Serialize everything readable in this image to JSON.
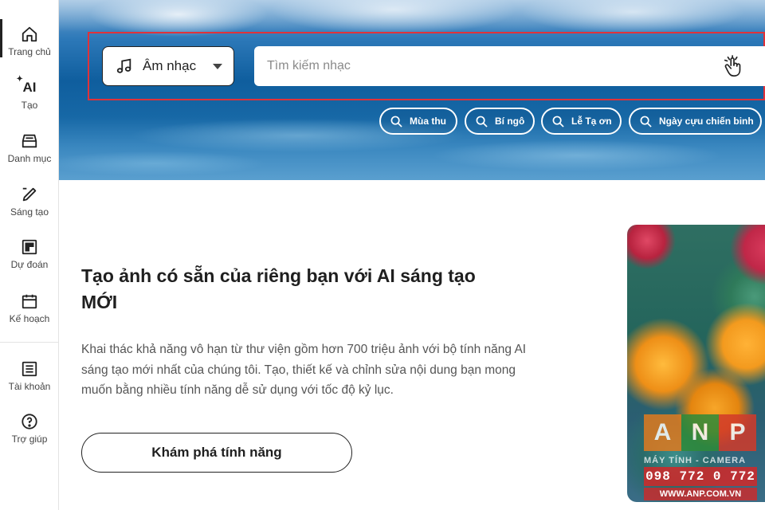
{
  "sidebar": {
    "items": [
      {
        "label": "Trang chủ",
        "icon": "home-icon"
      },
      {
        "label": "Tạo",
        "icon": "ai-sparkle-icon",
        "icon_text": "AI"
      },
      {
        "label": "Danh mục",
        "icon": "inbox-tray-icon"
      },
      {
        "label": "Sáng tạo",
        "icon": "edit-pen-icon"
      },
      {
        "label": "Dự đoán",
        "icon": "grid-dashboard-icon"
      },
      {
        "label": "Kế hoạch",
        "icon": "calendar-icon"
      },
      {
        "label": "Tài khoản",
        "icon": "list-account-icon"
      },
      {
        "label": "Trợ giúp",
        "icon": "help-circle-icon"
      }
    ],
    "active_index": 0
  },
  "search": {
    "type_selected": "Âm nhạc",
    "type_icon": "music-note-icon",
    "placeholder": "Tìm kiếm nhạc",
    "value": "",
    "action_icon": "hand-pointer-icon",
    "frame_color": "#e0323a"
  },
  "chips": [
    {
      "label": "Mùa thu"
    },
    {
      "label": "Bí ngô"
    },
    {
      "label": "Lễ Tạ ơn"
    },
    {
      "label": "Ngày cựu chiến binh"
    }
  ],
  "promo": {
    "title": "Tạo ảnh có sẵn của riêng bạn với AI sáng tạo MỚI",
    "body": "Khai thác khả năng vô hạn từ thư viện gồm hơn 700 triệu ảnh với bộ tính năng AI sáng tạo mới nhất của chúng tôi. Tạo, thiết kế và chỉnh sửa nội dung bạn mong muốn bằng nhiều tính năng dễ sử dụng với tốc độ kỷ lục.",
    "cta_label": "Khám phá tính năng"
  },
  "watermark": {
    "letters": [
      "A",
      "N",
      "P"
    ],
    "letter_colors": [
      "#e07a1f",
      "#2e8b3a",
      "#d23a2a"
    ],
    "tagline": "MÁY TÍNH - CAMERA",
    "phone": "098 772 0 772",
    "url": "WWW.ANP.COM.VN"
  }
}
